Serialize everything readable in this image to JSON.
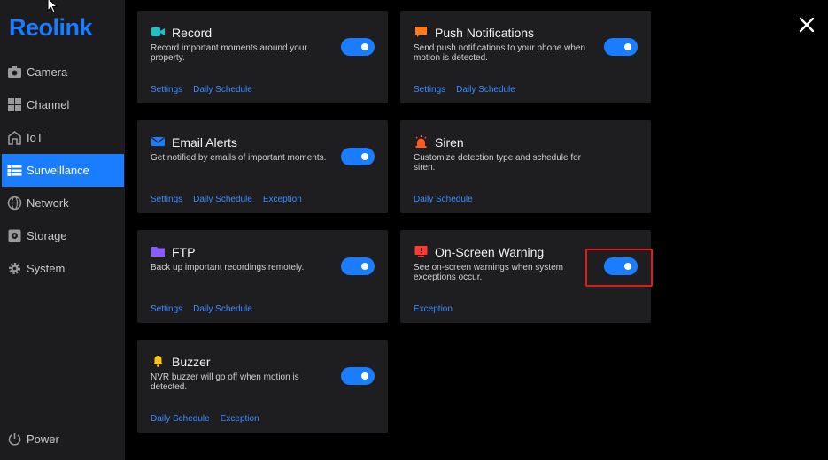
{
  "brand": {
    "logo": "Reolink",
    "accent": "#1a7cff"
  },
  "sidebar": {
    "items": [
      {
        "label": "Camera",
        "icon": "camera-icon"
      },
      {
        "label": "Channel",
        "icon": "channel-icon"
      },
      {
        "label": "IoT",
        "icon": "iot-icon"
      },
      {
        "label": "Surveillance",
        "icon": "list-icon",
        "active": true
      },
      {
        "label": "Network",
        "icon": "globe-icon"
      },
      {
        "label": "Storage",
        "icon": "storage-icon"
      },
      {
        "label": "System",
        "icon": "gear-icon"
      }
    ],
    "power": {
      "label": "Power",
      "icon": "power-icon"
    }
  },
  "cards": [
    {
      "title": "Record",
      "icon": "video-icon",
      "icon_color": "#19c3c9",
      "desc": "Record important moments around your property.",
      "toggle": true,
      "links": [
        "Settings",
        "Daily Schedule"
      ]
    },
    {
      "title": "Push Notifications",
      "icon": "chat-icon",
      "icon_color": "#ff7a1a",
      "desc": "Send push notifications to your phone when motion is detected.",
      "toggle": true,
      "links": [
        "Settings",
        "Daily Schedule"
      ]
    },
    {
      "title": "Email Alerts",
      "icon": "mail-icon",
      "icon_color": "#1a7cff",
      "desc": "Get notified by emails of important moments.",
      "toggle": true,
      "links": [
        "Settings",
        "Daily Schedule",
        "Exception"
      ]
    },
    {
      "title": "Siren",
      "icon": "siren-icon",
      "icon_color": "#ff5a1a",
      "desc": "Customize detection type and schedule for siren.",
      "toggle": false,
      "links": [
        "Daily Schedule"
      ]
    },
    {
      "title": "FTP",
      "icon": "folder-icon",
      "icon_color": "#8a5cff",
      "desc": "Back up important recordings remotely.",
      "toggle": true,
      "links": [
        "Settings",
        "Daily Schedule"
      ]
    },
    {
      "title": "On-Screen Warning",
      "icon": "warning-screen-icon",
      "icon_color": "#ff3b30",
      "desc": "See on-screen warnings when system exceptions occur.",
      "toggle": true,
      "links": [
        "Exception"
      ]
    },
    {
      "title": "Buzzer",
      "icon": "bell-icon",
      "icon_color": "#ffc21a",
      "desc": "NVR buzzer will go off when motion is detected.",
      "toggle": true,
      "links": [
        "Daily Schedule",
        "Exception"
      ]
    }
  ],
  "close": {
    "icon": "close-icon"
  }
}
